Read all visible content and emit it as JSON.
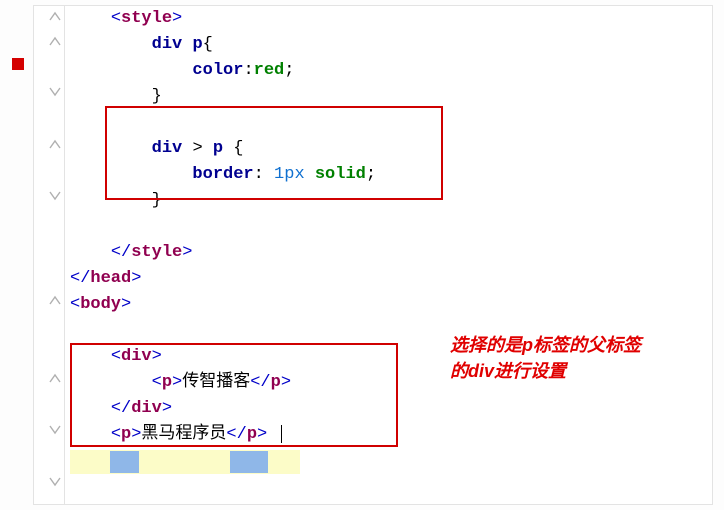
{
  "code": {
    "l1": "    <style>",
    "l2": "        div p{",
    "l3": "            color:red;",
    "l4": "        }",
    "l5": "",
    "l6": "        div > p {",
    "l7": "            border: 1px solid;",
    "l8": "        }",
    "l9": "",
    "l10": "    </style>",
    "l11": "</head>",
    "l12": "<body>",
    "l13": "",
    "l14": "    <div>",
    "l15": "        <p>传智播客</p>",
    "l16": "    </div>",
    "l17": "    <p>黑马程序员</p>"
  },
  "annotation": {
    "line1": "选择的是p标签的父标签",
    "line2": "的div进行设置"
  },
  "text": {
    "body15": "传智播客",
    "body17": "黑马程序员"
  }
}
